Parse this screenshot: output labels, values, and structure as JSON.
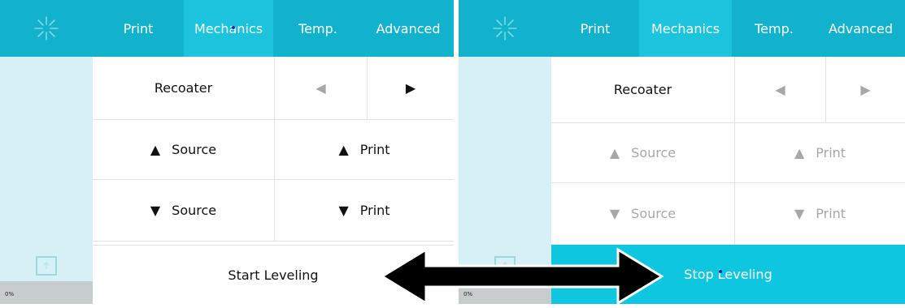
{
  "left_screen": {
    "tabs": [
      {
        "label": "Print",
        "active": false
      },
      {
        "label": "Mechanics",
        "active": true
      },
      {
        "label": "Temp.",
        "active": false
      },
      {
        "label": "Advanced",
        "active": false
      }
    ],
    "recoater_label": "Recoater",
    "source_up_label": "Source",
    "print_up_label": "Print",
    "source_down_label": "Source",
    "print_down_label": "Print",
    "leveling_label": "Start Leveling",
    "progress_text": "0%",
    "controls_enabled": true
  },
  "right_screen": {
    "tabs": [
      {
        "label": "Print",
        "active": false
      },
      {
        "label": "Mechanics",
        "active": true
      },
      {
        "label": "Temp.",
        "active": false
      },
      {
        "label": "Advanced",
        "active": false
      }
    ],
    "recoater_label": "Recoater",
    "source_up_label": "Source",
    "print_up_label": "Print",
    "source_down_label": "Source",
    "print_down_label": "Print",
    "leveling_label": "Stop Leveling",
    "progress_text": "0%",
    "controls_enabled": false
  },
  "colors": {
    "topbar": "#12b2cc",
    "active_tab": "#1bc3dd",
    "sidebar": "#d6f1f6",
    "stop_leveling_bg": "#0ec6df",
    "disabled_text": "#a7a7a7"
  },
  "icons": {
    "logo": "starburst-logo-icon",
    "upload": "upload-icon",
    "left": "arrow-left-icon",
    "right": "arrow-right-icon",
    "up": "triangle-up-icon",
    "down": "triangle-down-icon",
    "annotation": "double-headed-arrow-icon"
  }
}
